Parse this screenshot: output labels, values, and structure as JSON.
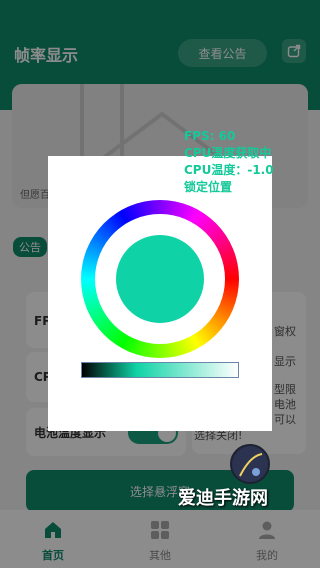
{
  "header": {
    "title": "帧率显示",
    "notice_button": "查看公告",
    "share_icon": "share-icon"
  },
  "banner": {
    "caption": "但愿百"
  },
  "notice": {
    "tag": "公告"
  },
  "rows": {
    "fps_label": "FP",
    "cpu_label": "CP",
    "battery_label": "电池温度显示",
    "toggle_on": true
  },
  "side_card": {
    "line1": "窗权",
    "line2": "显示",
    "line3": "型限",
    "line4": "电池",
    "line5": "可以",
    "line6": "选择关闭!"
  },
  "select_button": "选择悬浮窗",
  "tabs": [
    {
      "label": "首页",
      "icon": "home-icon",
      "active": true
    },
    {
      "label": "其他",
      "icon": "grid-icon",
      "active": false
    },
    {
      "label": "我的",
      "icon": "user-icon",
      "active": false
    }
  ],
  "fps_overlay": {
    "line1": "FPS: 60",
    "line2": "CPU温度获取中",
    "line3": "CPU温度：-1.0",
    "line4": "锁定位置"
  },
  "color_picker": {
    "selected_color": "#0fd3a6"
  },
  "watermark": "爱迪手游网",
  "colors": {
    "primary": "#0f8a6a",
    "accent": "#14c99a"
  }
}
